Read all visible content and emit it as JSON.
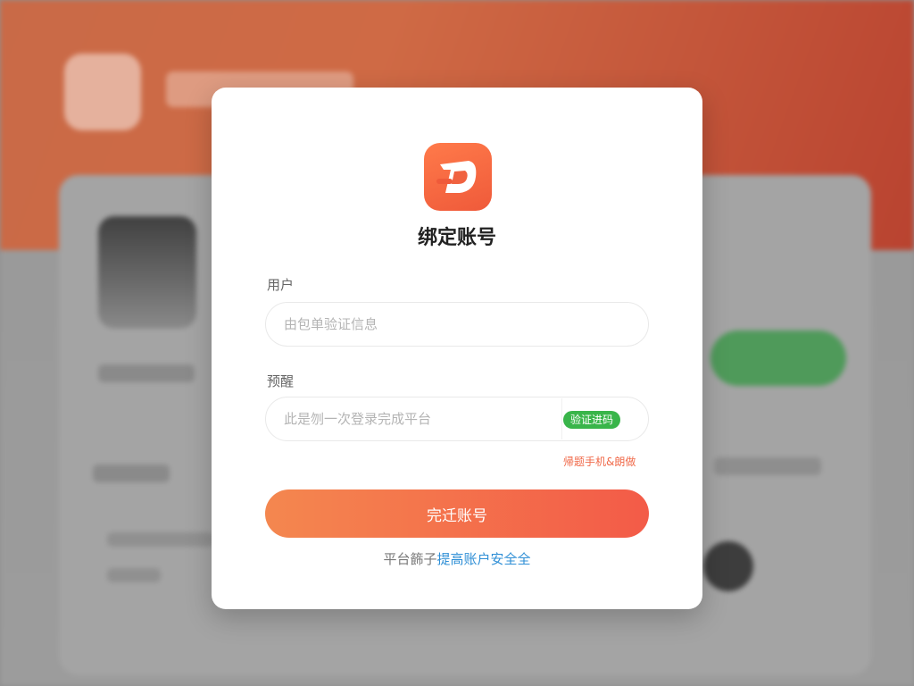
{
  "dialog": {
    "title": "绑定账号",
    "user_label": "用户",
    "user_placeholder": "由包单验证信息",
    "code_label": "预醒",
    "code_placeholder": "此是刎一次登录完成平台",
    "code_button": "验证进码",
    "help_link": "帰题手机&朗做",
    "submit_label": "完迁账号",
    "footer_text": "平台籂子",
    "footer_link": "提高账户安全全"
  },
  "colors": {
    "accent_orange": "#f35b48",
    "green_button": "#39b54a",
    "link_blue": "#2f8fd6"
  }
}
